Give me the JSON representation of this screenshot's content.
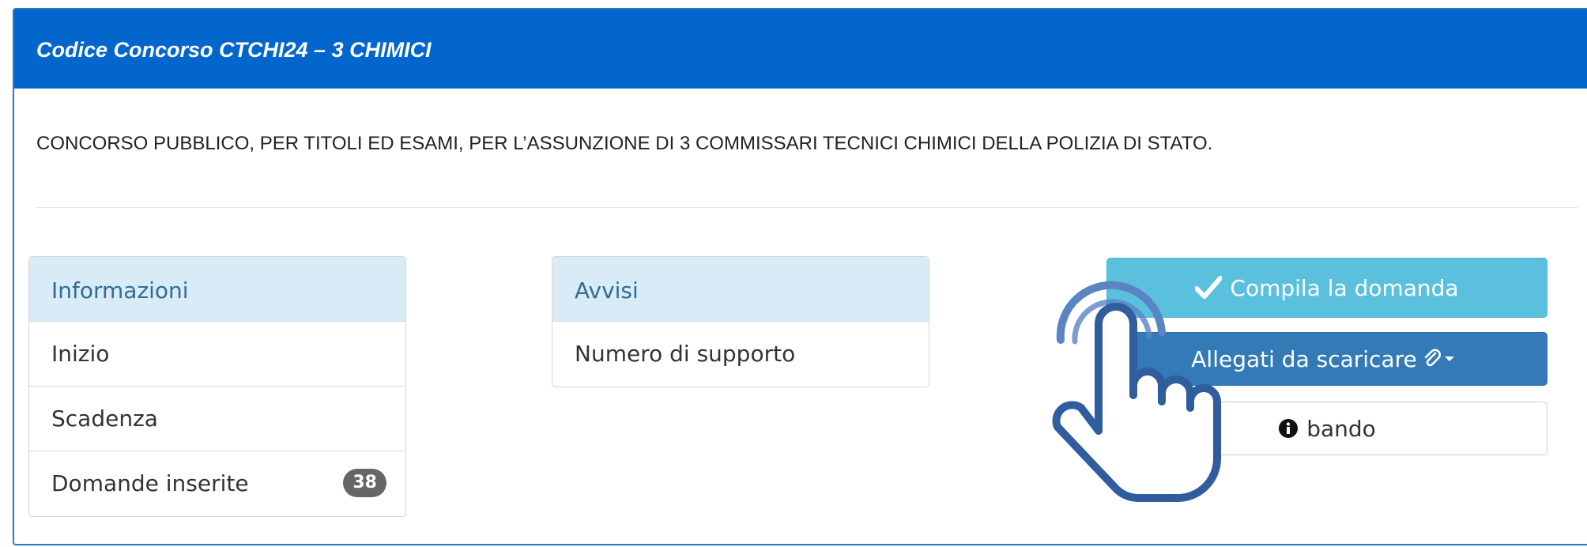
{
  "panel": {
    "title": "Codice Concorso CTCHI24 – 3 CHIMICI",
    "description": "CONCORSO PUBBLICO, PER TITOLI ED ESAMI, PER L’ASSUNZIONE DI 3 COMMISSARI TECNICI CHIMICI DELLA POLIZIA DI STATO."
  },
  "info": {
    "heading": "Informazioni",
    "rows": [
      {
        "label": "Inizio"
      },
      {
        "label": "Scadenza"
      },
      {
        "label": "Domande inserite",
        "badge": "38"
      }
    ]
  },
  "avvisi": {
    "heading": "Avvisi",
    "rows": [
      {
        "label": "Numero di supporto"
      }
    ]
  },
  "actions": {
    "compila_label": "Compila la domanda",
    "compila_icon": "check-icon",
    "allegati_label": "Allegati da scaricare",
    "allegati_icons": [
      "paperclip-icon",
      "caret-down-icon"
    ],
    "bando_label": "bando",
    "bando_icon": "info-circle-icon"
  },
  "overlay": {
    "icon": "pointing-hand-cursor-icon"
  },
  "colors": {
    "header_bg": "#0366cc",
    "list_head_bg": "#d9ebf6",
    "list_head_text": "#2f6f93",
    "compila_bg": "#5bc0de",
    "allegati_bg": "#337ab7",
    "badge_bg": "#666666",
    "hand_stroke": "#2f5d9e"
  }
}
